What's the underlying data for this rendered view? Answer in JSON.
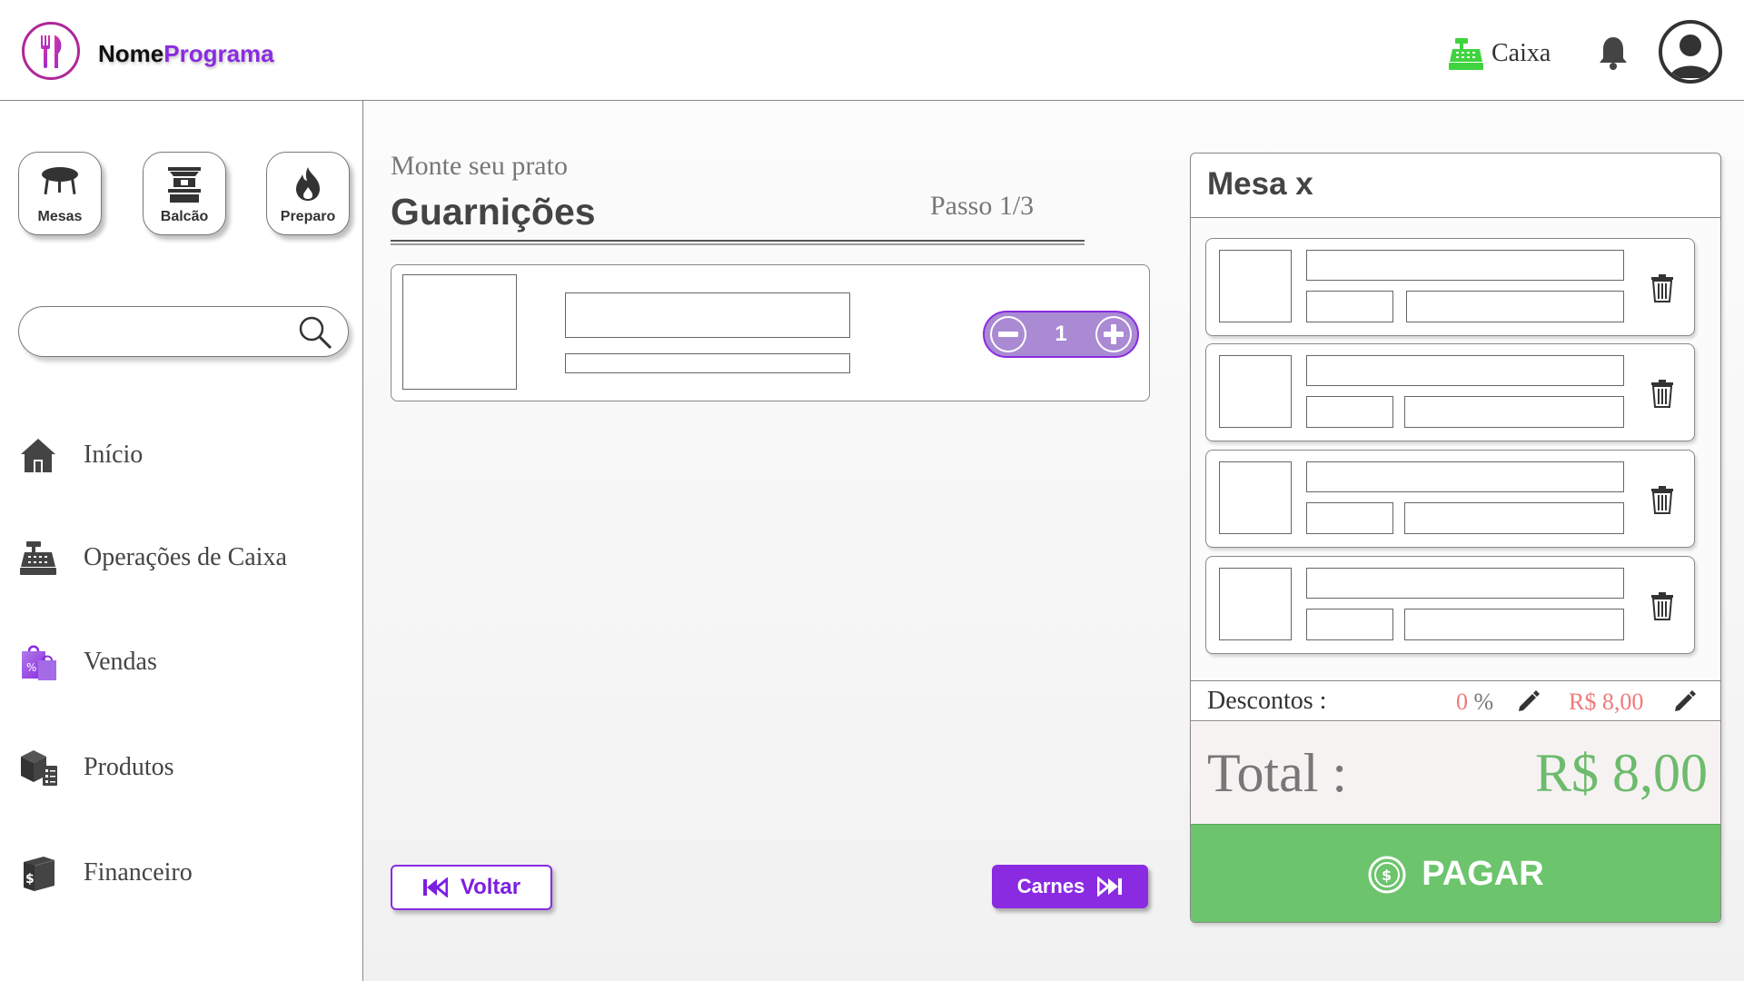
{
  "header": {
    "brand_part1": "Nome",
    "brand_part2": "Programa",
    "caixa_label": "Caixa",
    "colors": {
      "brand": "#8a2be2",
      "caixa_icon": "#3fd43f"
    }
  },
  "sidebar": {
    "quick_buttons": [
      {
        "label": "Mesas",
        "icon": "table-icon"
      },
      {
        "label": "Balcão",
        "icon": "counter-icon"
      },
      {
        "label": "Preparo",
        "icon": "fire-icon"
      }
    ],
    "search": {
      "placeholder": ""
    },
    "nav": [
      {
        "label": "Início",
        "icon": "home-icon"
      },
      {
        "label": "Operações de Caixa",
        "icon": "cash-register-icon"
      },
      {
        "label": "Vendas",
        "icon": "shopping-bags-icon"
      },
      {
        "label": "Produtos",
        "icon": "boxes-icon"
      },
      {
        "label": "Financeiro",
        "icon": "money-book-icon"
      }
    ]
  },
  "main": {
    "subtitle": "Monte seu prato",
    "title": "Guarnições",
    "step": "Passo 1/3",
    "quantity": "1",
    "back_label": "Voltar",
    "next_label": "Carnes"
  },
  "order": {
    "title": "Mesa x",
    "discount_label": "Descontos :",
    "discount_percent": "0",
    "percent_sign": "%",
    "discount_value": "R$ 8,00",
    "total_label": "Total :",
    "total_value": "R$ 8,00",
    "pay_label": "PAGAR",
    "colors": {
      "pay": "#6cc46c",
      "discount": "#f07a7a",
      "total": "#6dbb6d"
    }
  }
}
